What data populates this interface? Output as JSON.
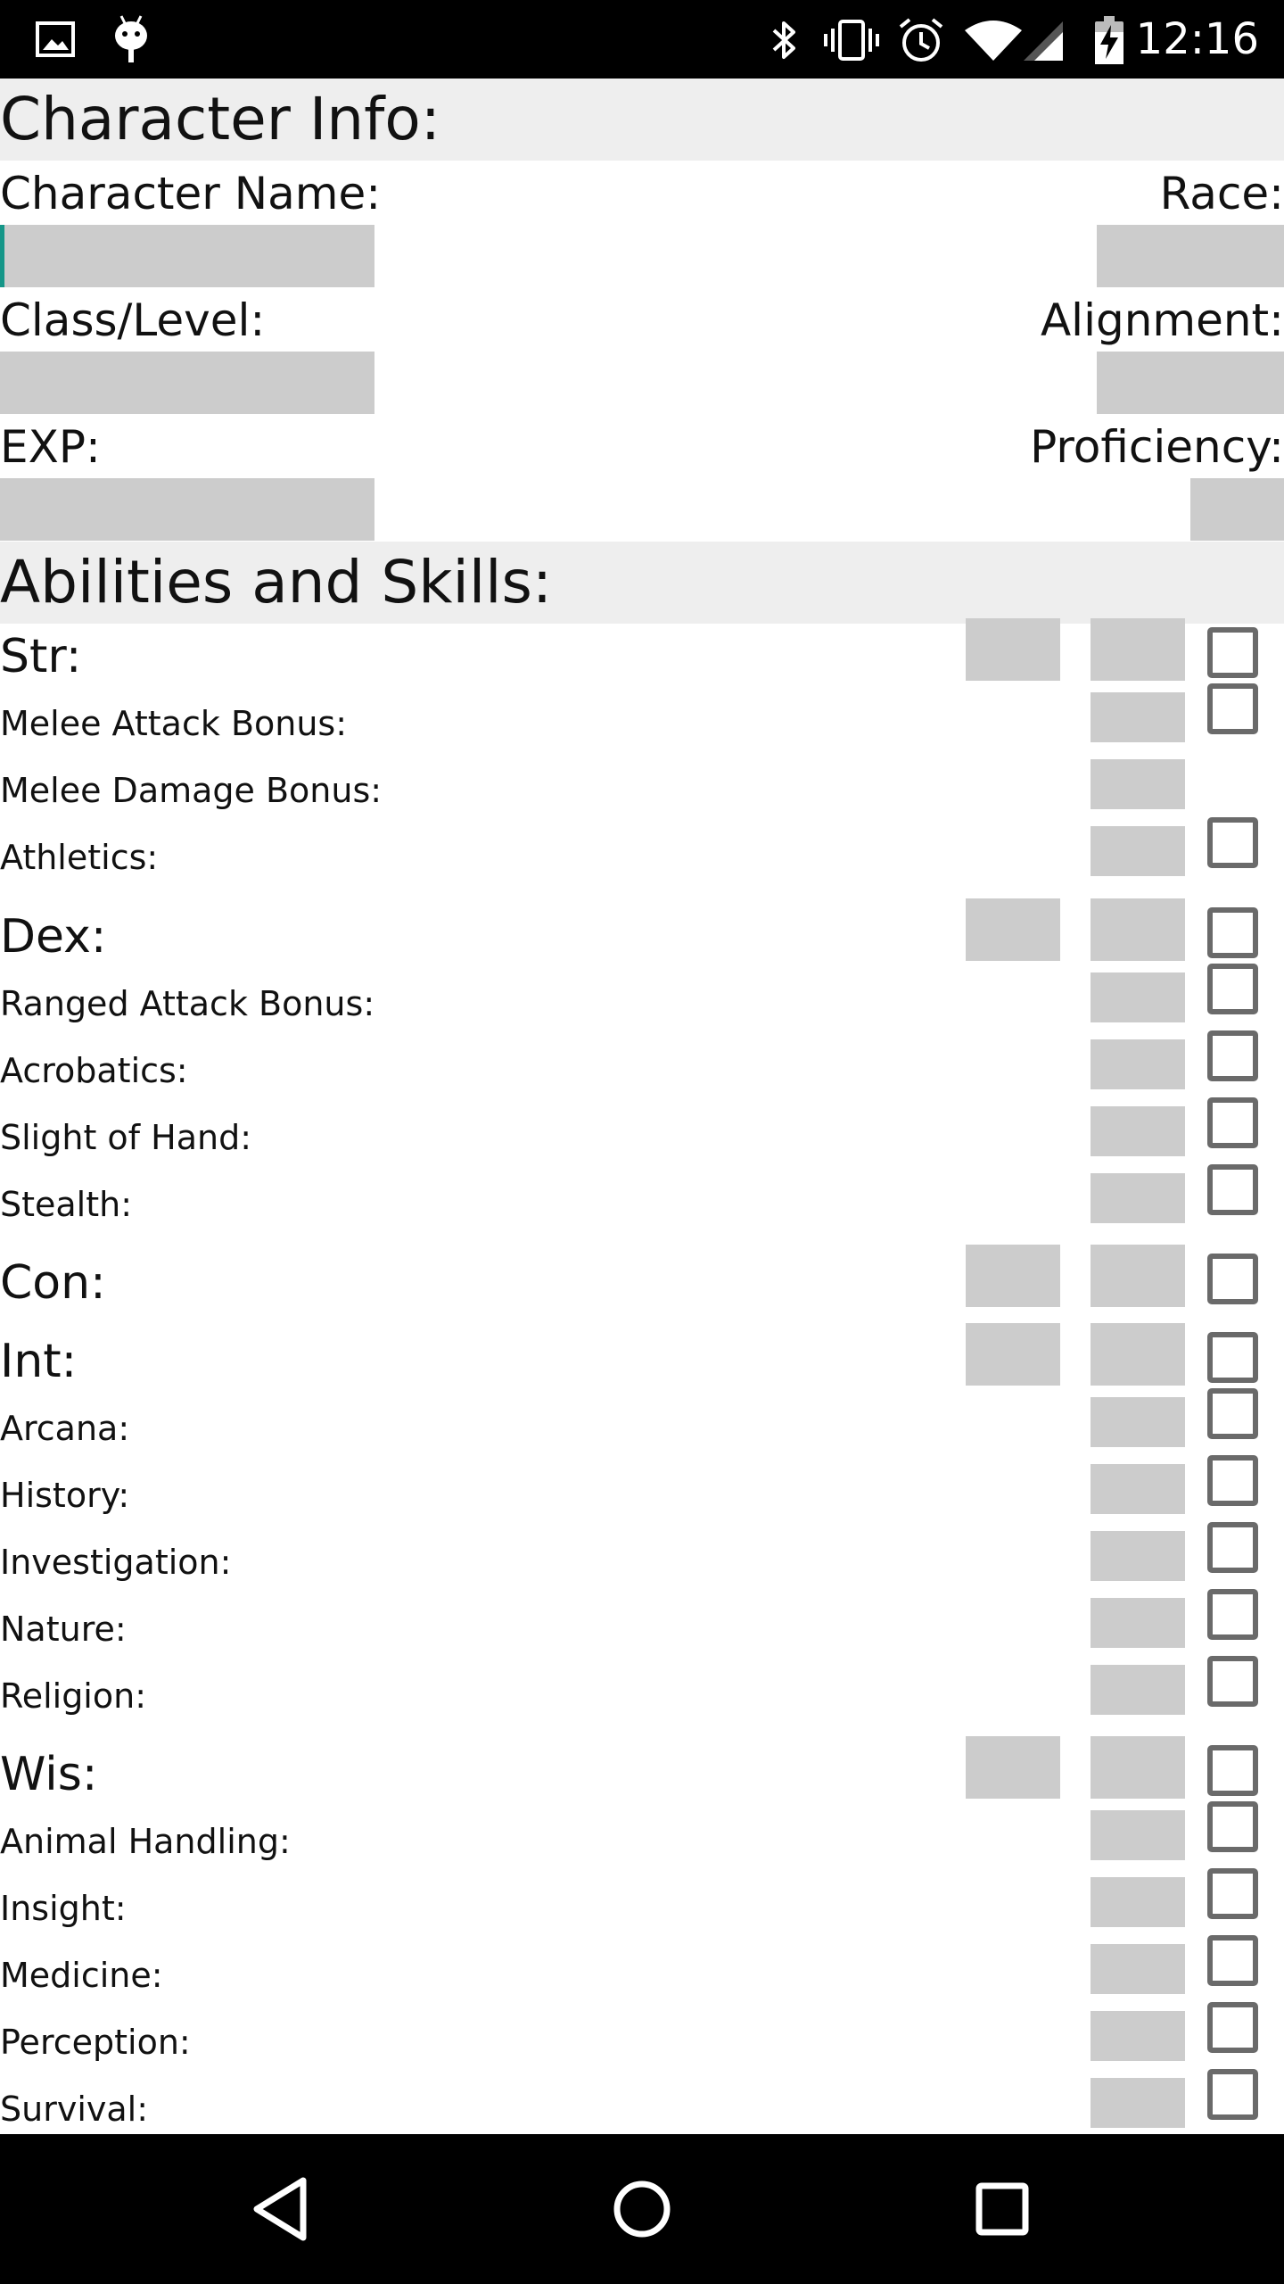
{
  "status_bar": {
    "time": "12:16",
    "left_icons": [
      "image-icon",
      "android-icon"
    ],
    "right_icons": [
      "bluetooth-icon",
      "vibrate-icon",
      "alarm-icon",
      "wifi-icon",
      "signal-icon",
      "battery-charging-icon"
    ]
  },
  "character_info": {
    "header": "Character Info:",
    "fields": {
      "character_name": {
        "label": "Character Name:",
        "value": ""
      },
      "race": {
        "label": "Race:",
        "value": ""
      },
      "class_level": {
        "label": "Class/Level:",
        "value": ""
      },
      "alignment": {
        "label": "Alignment:",
        "value": ""
      },
      "exp": {
        "label": "EXP:",
        "value": ""
      },
      "proficiency": {
        "label": "Proficiency:",
        "value": ""
      }
    }
  },
  "abilities": {
    "header": "Abilities and Skills:",
    "rows": [
      {
        "label": "Str:",
        "type": "ability",
        "score_box": true,
        "mod_box": true,
        "checkbox": true
      },
      {
        "label": "Melee Attack Bonus:",
        "type": "skill",
        "score_box": false,
        "mod_box": true,
        "checkbox": true
      },
      {
        "label": "Melee Damage Bonus:",
        "type": "skill",
        "score_box": false,
        "mod_box": true,
        "checkbox": false
      },
      {
        "label": "Athletics:",
        "type": "skill",
        "score_box": false,
        "mod_box": true,
        "checkbox": true
      },
      {
        "label": "Dex:",
        "type": "ability",
        "score_box": true,
        "mod_box": true,
        "checkbox": true
      },
      {
        "label": "Ranged Attack Bonus:",
        "type": "skill",
        "score_box": false,
        "mod_box": true,
        "checkbox": true
      },
      {
        "label": "Acrobatics:",
        "type": "skill",
        "score_box": false,
        "mod_box": true,
        "checkbox": true
      },
      {
        "label": "Slight of Hand:",
        "type": "skill",
        "score_box": false,
        "mod_box": true,
        "checkbox": true
      },
      {
        "label": "Stealth:",
        "type": "skill",
        "score_box": false,
        "mod_box": true,
        "checkbox": true
      },
      {
        "label": "Con:",
        "type": "ability",
        "score_box": true,
        "mod_box": true,
        "checkbox": true
      },
      {
        "label": "Int:",
        "type": "ability",
        "score_box": true,
        "mod_box": true,
        "checkbox": true
      },
      {
        "label": "Arcana:",
        "type": "skill",
        "score_box": false,
        "mod_box": true,
        "checkbox": true
      },
      {
        "label": "History:",
        "type": "skill",
        "score_box": false,
        "mod_box": true,
        "checkbox": true
      },
      {
        "label": "Investigation:",
        "type": "skill",
        "score_box": false,
        "mod_box": true,
        "checkbox": true
      },
      {
        "label": "Nature:",
        "type": "skill",
        "score_box": false,
        "mod_box": true,
        "checkbox": true
      },
      {
        "label": "Religion:",
        "type": "skill",
        "score_box": false,
        "mod_box": true,
        "checkbox": true
      },
      {
        "label": "Wis:",
        "type": "ability",
        "score_box": true,
        "mod_box": true,
        "checkbox": true
      },
      {
        "label": "Animal Handling:",
        "type": "skill",
        "score_box": false,
        "mod_box": true,
        "checkbox": true
      },
      {
        "label": "Insight:",
        "type": "skill",
        "score_box": false,
        "mod_box": true,
        "checkbox": true
      },
      {
        "label": "Medicine:",
        "type": "skill",
        "score_box": false,
        "mod_box": true,
        "checkbox": true
      },
      {
        "label": "Perception:",
        "type": "skill",
        "score_box": false,
        "mod_box": true,
        "checkbox": true
      },
      {
        "label": "Survival:",
        "type": "skill",
        "score_box": false,
        "mod_box": true,
        "checkbox": true
      }
    ]
  },
  "nav_bar": {
    "buttons": [
      "back-icon",
      "home-icon",
      "recents-icon"
    ]
  },
  "colors": {
    "status_bar": "#000000",
    "section_header_bg": "#eeeeee",
    "field_bg": "#cccccc",
    "focus_accent": "#159688",
    "checkbox_border": "#6a6a6a",
    "nav_bar": "#000000"
  }
}
